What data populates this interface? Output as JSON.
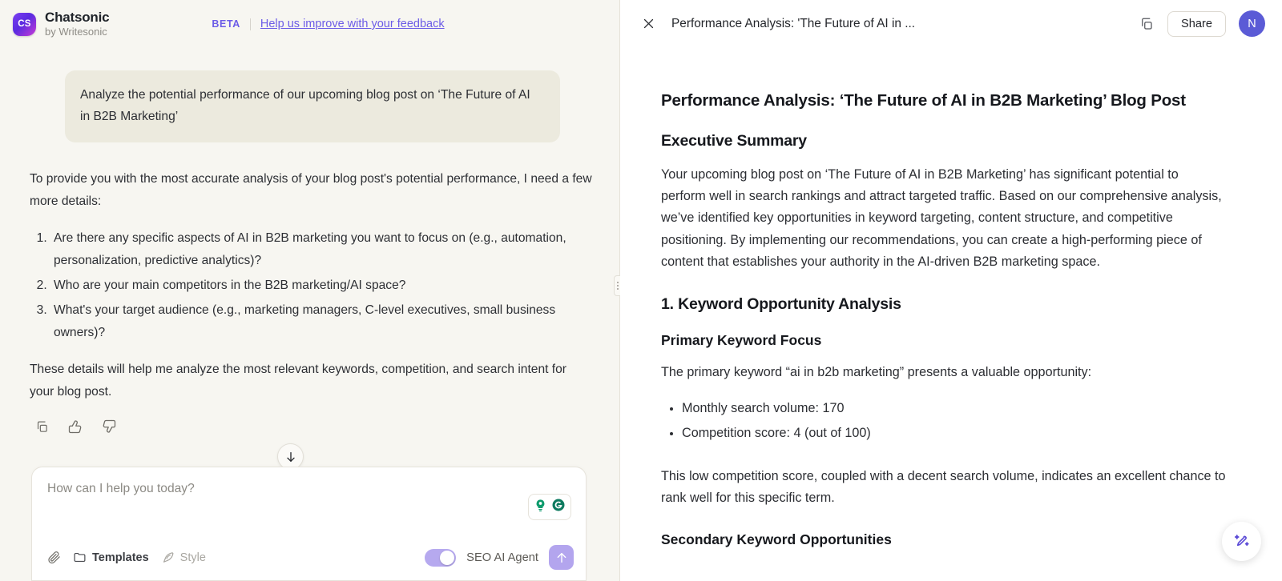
{
  "chat": {
    "brand": {
      "name": "Chatsonic",
      "sub": "by Writesonic",
      "logo_text": "CS"
    },
    "beta_tag": "BETA",
    "feedback_link": "Help us improve with your feedback",
    "user_message": "Analyze the potential performance of our upcoming blog post on ‘The Future of AI in B2B Marketing’",
    "assistant": {
      "intro": "To provide you with the most accurate analysis of your blog post's potential performance, I need a few more details:",
      "questions": [
        "Are there any specific aspects of AI in B2B marketing you want to focus on (e.g., automation, personalization, predictive analytics)?",
        "Who are your main competitors in the B2B marketing/AI space?",
        "What's your target audience (e.g., marketing managers, C-level executives, small business owners)?"
      ],
      "outro": "These details will help me analyze the most relevant keywords, competition, and search intent for your blog post."
    },
    "actions": {
      "copy": "copy-icon",
      "like": "thumbs-up-icon",
      "dislike": "thumbs-down-icon"
    },
    "scroll_down": "scroll-to-bottom",
    "composer": {
      "placeholder": "How can I help you today?",
      "attach_label": "",
      "templates_label": "Templates",
      "style_label": "Style",
      "toggle_label": "SEO AI Agent",
      "toggle_on": true,
      "send_label": ""
    }
  },
  "document": {
    "header_title": "Performance Analysis: 'The Future of AI in ...",
    "share_label": "Share",
    "avatar_initial": "N",
    "title": "Performance Analysis: ‘The Future of AI in B2B Marketing’ Blog Post",
    "sections": [
      {
        "heading": "Executive Summary",
        "paragraph": "Your upcoming blog post on ‘The Future of AI in B2B Marketing’ has significant potential to perform well in search rankings and attract targeted traffic. Based on our comprehensive analysis, we’ve identified key opportunities in keyword targeting, content structure, and competitive positioning. By implementing our recommendations, you can create a high-performing piece of content that establishes your authority in the AI-driven B2B marketing space."
      }
    ],
    "section_one_heading": "1. Keyword Opportunity Analysis",
    "primary_keyword_heading": "Primary Keyword Focus",
    "primary_keyword_intro": "The primary keyword “ai in b2b marketing” presents a valuable opportunity:",
    "keyword_metrics": [
      "Monthly search volume: 170",
      "Competition score: 4 (out of 100)"
    ],
    "keyword_conclusion": "This low competition score, coupled with a decent search volume, indicates an excellent chance to rank well for this specific term.",
    "secondary_heading": "Secondary Keyword Opportunities"
  },
  "colors": {
    "accent_purple": "#6c5ce7",
    "chat_bg": "#f7f6f1",
    "bubble_bg": "#eceade",
    "toggle_on": "#b6a9ef",
    "avatar_bg": "#5b5bd6",
    "grammarly_green": "#15a36e"
  }
}
